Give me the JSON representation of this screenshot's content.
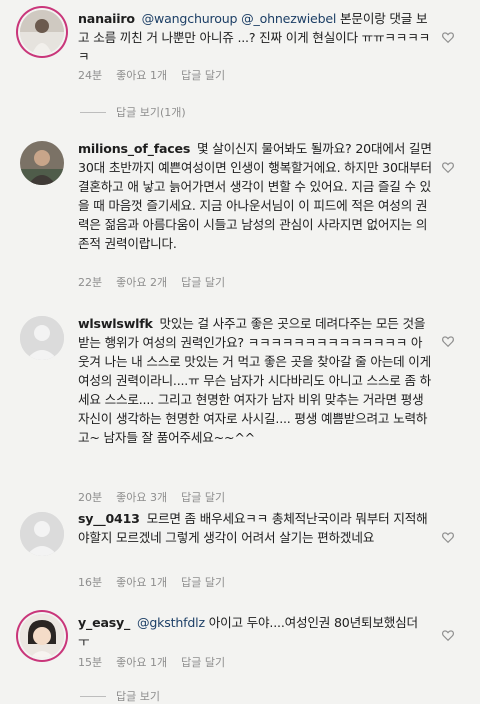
{
  "comments": [
    {
      "username": "nanaiiro",
      "mention1": "@wangchuroup",
      "mention2": "@_ohnezwiebel",
      "text_line1_tail": "본문이랑",
      "text_rest": "댓글 보고 소름 끼친 거 나뿐만 아니쥬 ...? 진짜 이게 현실이다 ㅠㅠㅋㅋㅋㅋㅋ",
      "time": "24분",
      "likes": "좋아요 1개",
      "reply": "답글 달기",
      "view_replies": "답글 보기(1개)"
    },
    {
      "username": "milions_of_faces",
      "text": "몇 살이신지 물어봐도 될까요? 20대에서 길면 30대 초반까지 예쁜여성이면 인생이 행복할거에요. 하지만 30대부터 결혼하고 애 낳고 늙어가면서 생각이 변할 수 있어요. 지금 즐길 수 있을 때 마음껏 즐기세요. 지금 아나운서님이 이 피드에 적은 여성의 권력은 젊음과 아름다움이 시들고 남성의 관심이 사라지면 없어지는 의존적 권력이랍니다.",
      "time": "22분",
      "likes": "좋아요 2개",
      "reply": "답글 달기"
    },
    {
      "username": "wlswlswlfk",
      "text": "맛있는 걸 사주고 좋은 곳으로 데려다주는 모든 것을 받는 행위가 여성의 권력인가요? ㅋㅋㅋㅋㅋㅋㅋㅋㅋㅋㅋㅋㅋㅋ 아 웃겨 나는 내 스스로 맛있는 거 먹고 좋은 곳을 찾아갈 줄 아는데 이게 여성의 권력이라니....ㅠ 무슨 남자가 시다바리도 아니고 스스로 좀 하세요 스스로.... 그리고 현명한 여자가 남자 비위 맞추는 거라면 평생 자신이 생각하는 현명한 여자로 사시길.... 평생 예쁨받으려고 노력하고~ 남자들 잘 품어주세요~~^^",
      "time": "20분",
      "likes": "좋아요 3개",
      "reply": "답글 달기"
    },
    {
      "username": "sy__0413",
      "text": "모르면 좀 배우세요ㅋㅋ 총체적난국이라 뭐부터 지적해야할지 모르겠네 그렇게 생각이 어려서 살기는 편하겠네요",
      "time": "16분",
      "likes": "좋아요 1개",
      "reply": "답글 달기"
    },
    {
      "username": "y_easy_",
      "mention1": "@gksthfdlz",
      "text_tail": "아이고 두야....여성인권 80년퇴보했심더 ㅜ",
      "time": "15분",
      "likes": "좋아요 1개",
      "reply": "답글 달기",
      "view_replies": "답글 보기"
    }
  ],
  "colors": {
    "background": "#f3f3f1",
    "meta_text": "#8e8e8e",
    "mention": "#1d3f66",
    "story_ring": "#c9367a"
  },
  "icons": [
    "heart-outline-icon"
  ]
}
